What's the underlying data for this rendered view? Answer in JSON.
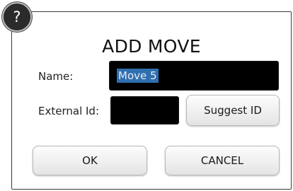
{
  "dialog": {
    "help_badge_label": "?",
    "title": "ADD MOVE",
    "name": {
      "label": "Name:",
      "value": "Move 5",
      "value_selected": true
    },
    "external_id": {
      "label": "External Id:",
      "value": ""
    },
    "buttons": {
      "suggest_id": "Suggest ID",
      "ok": "OK",
      "cancel": "CANCEL"
    }
  },
  "colors": {
    "field_background": "#000000",
    "selection_highlight": "#2f6fb0",
    "dialog_border": "#3a3a3a",
    "help_badge_background": "#2b2b2b"
  }
}
